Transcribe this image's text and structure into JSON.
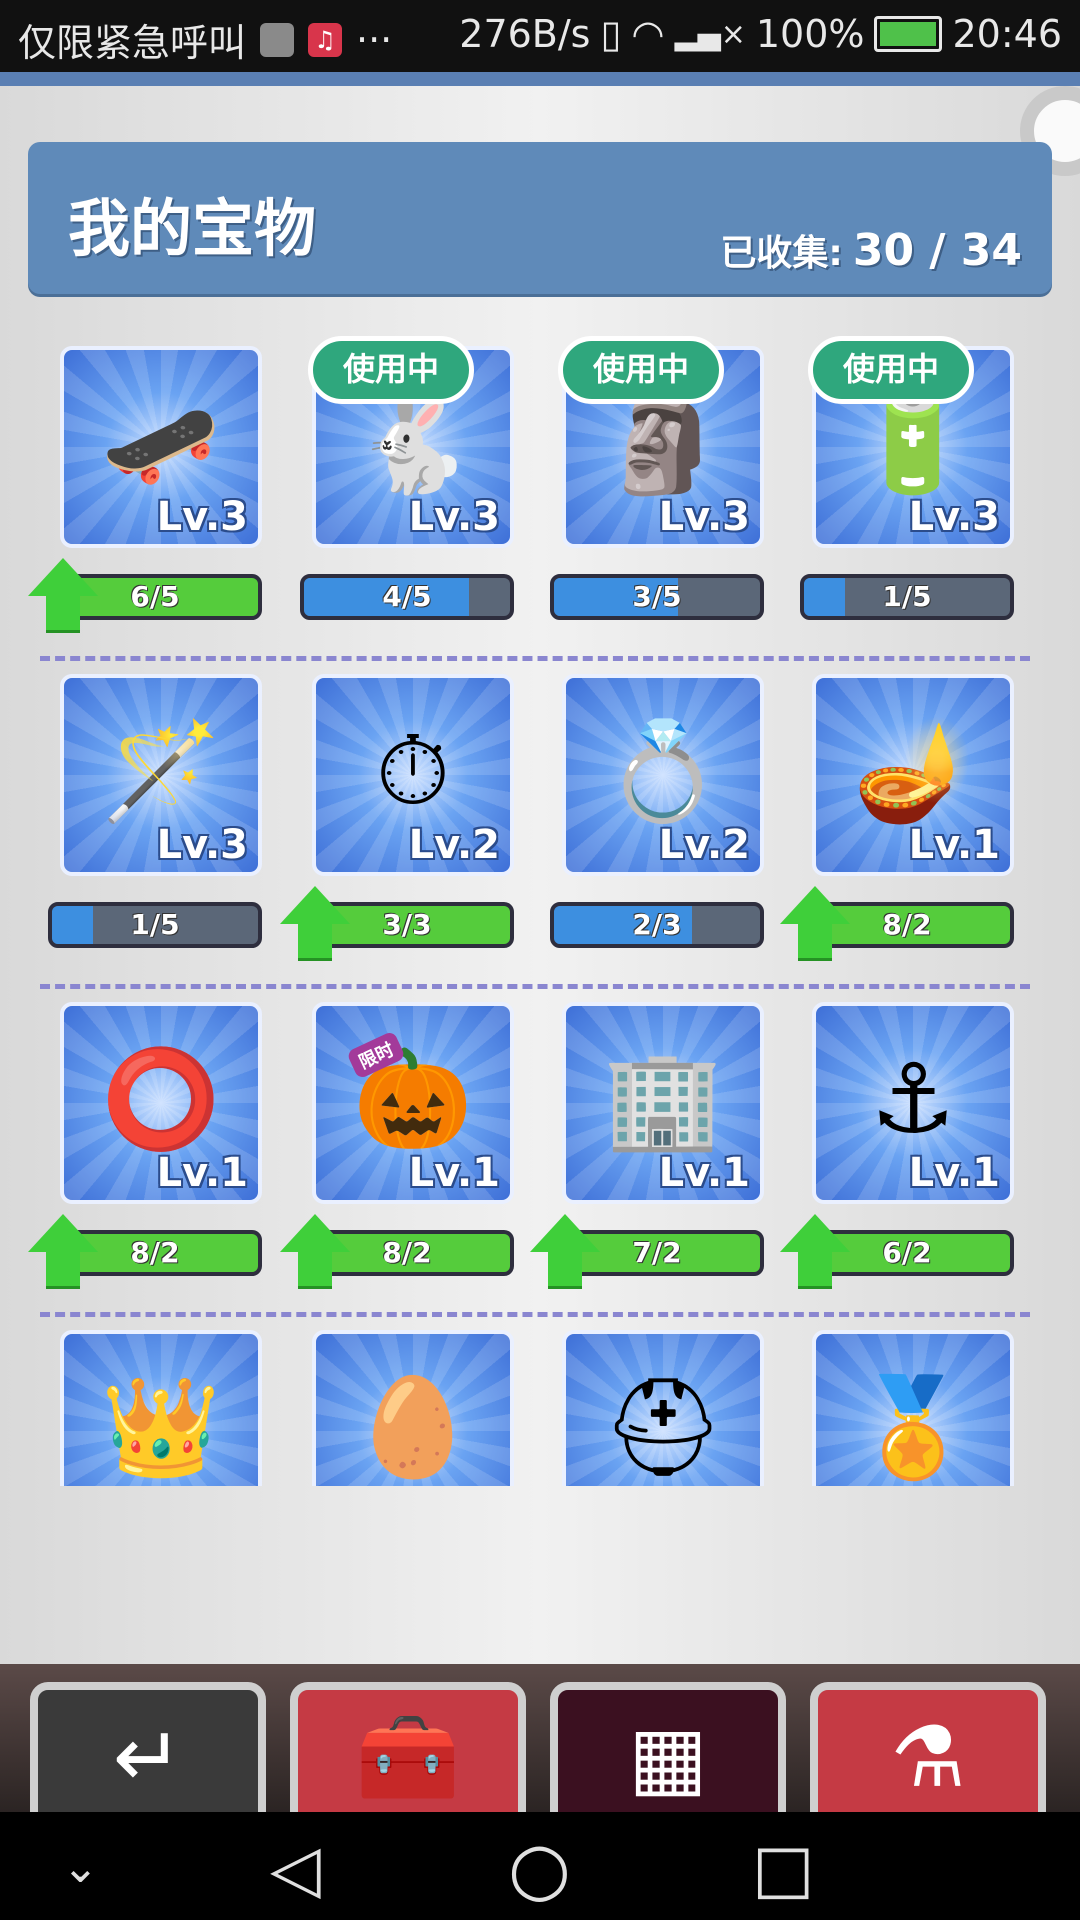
{
  "status_bar": {
    "carrier": "仅限紧急呼叫",
    "extra": "···",
    "net_speed": "276B/s",
    "battery": "100%",
    "time": "20:46"
  },
  "header": {
    "title": "我的宝物",
    "collected_label": "已收集:",
    "collected_value": "30 / 34"
  },
  "colors": {
    "header_bg": "#5f8ab9",
    "card_blue": "#3e6fd7",
    "progress_blue": "#3d8fe0",
    "progress_green": "#55cc3c",
    "in_use_green": "#2fa77d"
  },
  "treasures": [
    {
      "icon": "orange-board-icon",
      "glyph": "🛹",
      "level": "Lv.3",
      "progress": "6/5",
      "fill": 1.0,
      "upgradable": true,
      "in_use": ""
    },
    {
      "icon": "white-rabbit-icon",
      "glyph": "🐇",
      "level": "Lv.3",
      "progress": "4/5",
      "fill": 0.8,
      "upgradable": false,
      "in_use": "使用中"
    },
    {
      "icon": "golden-idol-icon",
      "glyph": "🗿",
      "level": "Lv.3",
      "progress": "3/5",
      "fill": 0.6,
      "upgradable": false,
      "in_use": "使用中"
    },
    {
      "icon": "device-icon",
      "glyph": "🔋",
      "level": "Lv.3",
      "progress": "1/5",
      "fill": 0.2,
      "upgradable": false,
      "in_use": "使用中"
    },
    {
      "icon": "ghost-scepter-icon",
      "glyph": "🪄",
      "level": "Lv.3",
      "progress": "1/5",
      "fill": 0.2,
      "upgradable": false,
      "in_use": ""
    },
    {
      "icon": "pocket-watch-icon",
      "glyph": "⏱",
      "level": "Lv.2",
      "progress": "3/3",
      "fill": 1.0,
      "upgradable": true,
      "in_use": ""
    },
    {
      "icon": "gold-rings-icon",
      "glyph": "💍",
      "level": "Lv.2",
      "progress": "2/3",
      "fill": 0.67,
      "upgradable": false,
      "in_use": ""
    },
    {
      "icon": "golden-lamp-icon",
      "glyph": "🪔",
      "level": "Lv.1",
      "progress": "8/2",
      "fill": 1.0,
      "upgradable": true,
      "in_use": ""
    },
    {
      "icon": "gold-halo-icon",
      "glyph": "⭕",
      "level": "Lv.1",
      "progress": "8/2",
      "fill": 1.0,
      "upgradable": true,
      "in_use": ""
    },
    {
      "icon": "pumpkin-icon",
      "glyph": "🎃",
      "level": "Lv.1",
      "progress": "8/2",
      "fill": 1.0,
      "upgradable": true,
      "in_use": "",
      "badge": "限时"
    },
    {
      "icon": "tower-icon",
      "glyph": "🏢",
      "level": "Lv.1",
      "progress": "7/2",
      "fill": 1.0,
      "upgradable": true,
      "in_use": ""
    },
    {
      "icon": "anchor-icon",
      "glyph": "⚓",
      "level": "Lv.1",
      "progress": "6/2",
      "fill": 1.0,
      "upgradable": true,
      "in_use": ""
    },
    {
      "icon": "crown-icon",
      "glyph": "👑",
      "level": "",
      "progress": "",
      "fill": 0,
      "upgradable": false,
      "in_use": ""
    },
    {
      "icon": "egg-icon",
      "glyph": "🥚",
      "level": "",
      "progress": "",
      "fill": 0,
      "upgradable": false,
      "in_use": ""
    },
    {
      "icon": "helmet-icon",
      "glyph": "⛑",
      "level": "",
      "progress": "",
      "fill": 0,
      "upgradable": false,
      "in_use": ""
    },
    {
      "icon": "medal-icon",
      "glyph": "🏅",
      "level": "",
      "progress": "",
      "fill": 0,
      "upgradable": false,
      "in_use": ""
    }
  ],
  "bottom_nav": [
    {
      "icon": "back-arrow-icon",
      "glyph": "↵",
      "style": "dark"
    },
    {
      "icon": "treasure-chest-icon",
      "glyph": "🧰",
      "style": "red"
    },
    {
      "icon": "checklist-grid-icon",
      "glyph": "▦",
      "style": "maroon"
    },
    {
      "icon": "potion-icon",
      "glyph": "⚗",
      "style": "red"
    }
  ],
  "android_nav": {
    "down": "⌄",
    "back": "◁",
    "home": "○",
    "recents": "□"
  }
}
